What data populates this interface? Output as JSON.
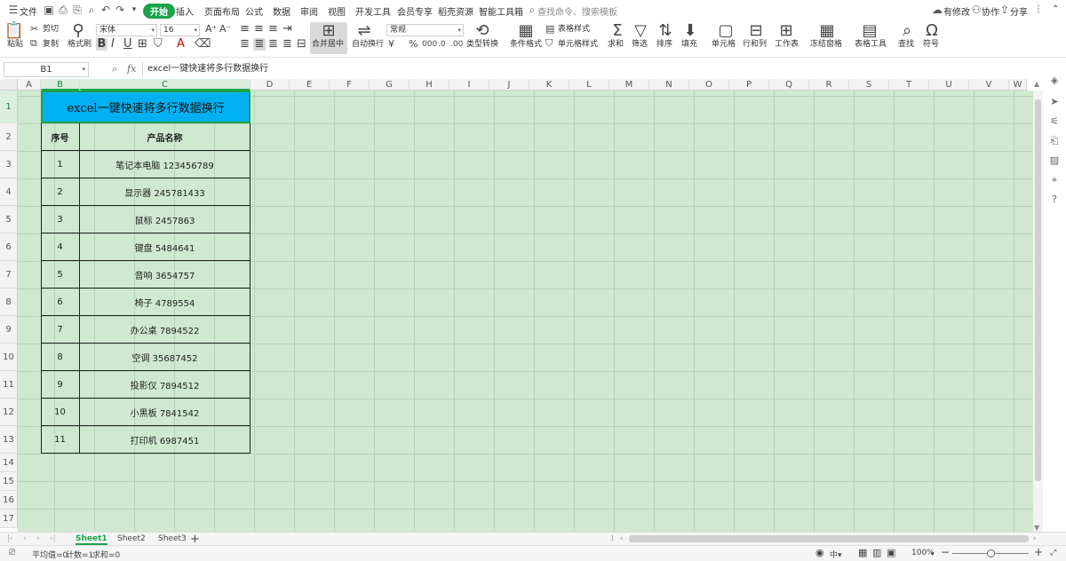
{
  "menubar": {
    "file": "文件",
    "tabs": [
      "开始",
      "插入",
      "页面布局",
      "公式",
      "数据",
      "审阅",
      "视图",
      "开发工具",
      "会员专享",
      "稻壳资源",
      "智能工具箱"
    ],
    "search": "查找命令、搜索模板",
    "modified": "有修改",
    "collab": "协作",
    "share": "分享"
  },
  "ribbon": {
    "paste": "粘贴",
    "cut": "剪切",
    "copy": "复制",
    "format_painter": "格式刷",
    "font": "宋体",
    "font_size": "16",
    "merge": "合并居中",
    "wrap": "自动换行",
    "number_format": "常规",
    "type_convert": "类型转换",
    "cond_format": "条件格式",
    "table_style": "表格样式",
    "cell_style": "单元格样式",
    "sum": "求和",
    "filter": "筛选",
    "sort": "排序",
    "fill": "填充",
    "cell": "单元格",
    "row_col": "行和列",
    "worksheet": "工作表",
    "freeze": "冻结窗格",
    "table_tools": "表格工具",
    "find": "查找",
    "symbol": "符号"
  },
  "formula_bar": {
    "name_box": "B1",
    "fx": "fx",
    "content": "excel一键快速将多行数据换行"
  },
  "columns": [
    "A",
    "B",
    "C",
    "D",
    "E",
    "F",
    "G",
    "H",
    "I",
    "J",
    "K",
    "L",
    "M",
    "N",
    "O",
    "P",
    "Q",
    "R",
    "S",
    "T",
    "U",
    "V",
    "W"
  ],
  "rows": [
    "1",
    "2",
    "3",
    "4",
    "5",
    "6",
    "7",
    "8",
    "9",
    "10",
    "11",
    "12",
    "13",
    "14",
    "15",
    "16",
    "17"
  ],
  "sheet": {
    "title": "excel一键快速将多行数据换行",
    "headers": [
      "序号",
      "产品名称"
    ],
    "items": [
      {
        "no": "1",
        "name": "笔记本电脑 123456789"
      },
      {
        "no": "2",
        "name": "显示器 245781433"
      },
      {
        "no": "3",
        "name": "鼠标 2457863"
      },
      {
        "no": "4",
        "name": "键盘 5484641"
      },
      {
        "no": "5",
        "name": "音响 3654757"
      },
      {
        "no": "6",
        "name": "椅子 4789554"
      },
      {
        "no": "7",
        "name": "办公桌 7894522"
      },
      {
        "no": "8",
        "name": "空调 35687452"
      },
      {
        "no": "9",
        "name": "投影仪 7894512"
      },
      {
        "no": "10",
        "name": "小黑板 7841542"
      },
      {
        "no": "11",
        "name": "打印机 6987451"
      }
    ]
  },
  "sheet_tabs": [
    "Sheet1",
    "Sheet2",
    "Sheet3"
  ],
  "status": {
    "avg": "平均值=0",
    "count": "计数=1",
    "sum": "求和=0",
    "zoom": "100%",
    "zoom_level": 0.5
  },
  "colors": {
    "accent": "#1aa34a",
    "title_fill": "#00b0f0",
    "eye_protection": "#cfe8cf"
  }
}
